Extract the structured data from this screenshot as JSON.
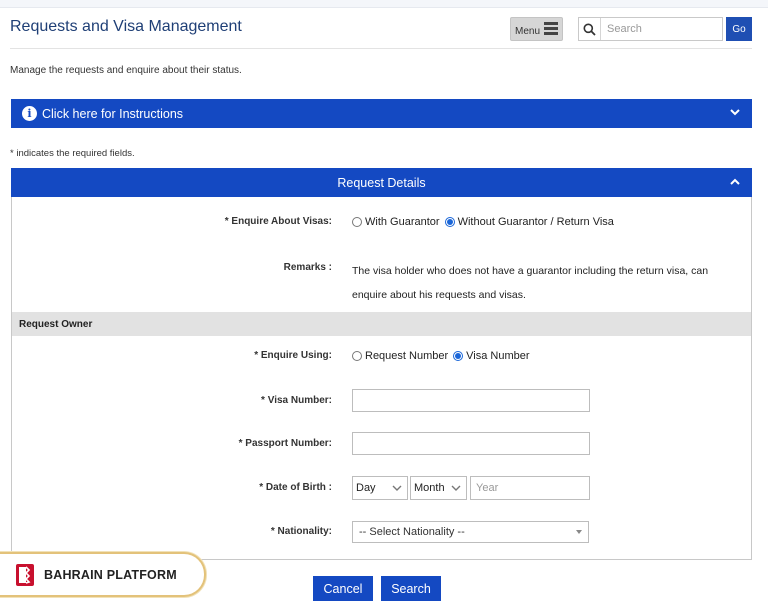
{
  "header": {
    "title": "Requests and Visa Management",
    "menu_label": "Menu",
    "search_placeholder": "Search",
    "go_label": "Go"
  },
  "intro_text": "Manage the requests and enquire about their status.",
  "instructions_label": "Click here for Instructions",
  "required_note": "* indicates the required fields.",
  "panel": {
    "title": "Request Details",
    "enquire_visas": {
      "label": "* Enquire About Visas:",
      "options": [
        "With Guarantor",
        "Without Guarantor / Return Visa"
      ],
      "selected": "Without Guarantor / Return Visa"
    },
    "remarks": {
      "label": "Remarks :",
      "text": "The visa holder who does not have a guarantor including the return visa, can enquire about his requests and visas."
    },
    "request_owner": {
      "title": "Request Owner",
      "enquire_using": {
        "label": "* Enquire Using:",
        "options": [
          "Request Number",
          "Visa Number"
        ],
        "selected": "Visa Number"
      },
      "visa_number_label": "* Visa Number:",
      "visa_number_value": "",
      "passport_number_label": "* Passport Number:",
      "passport_number_value": "",
      "dob": {
        "label": "* Date of Birth :",
        "day": "Day",
        "month": "Month",
        "year_placeholder": "Year"
      },
      "nationality": {
        "label": "* Nationality:",
        "selected": "-- Select Nationality --"
      }
    }
  },
  "buttons": {
    "cancel": "Cancel",
    "search": "Search"
  },
  "brand": "BAHRAIN PLATFORM",
  "colors": {
    "accent": "#1449c2",
    "title": "#1f3f76",
    "band": "#e2e2e2",
    "brand_border": "#e3c27a",
    "brand_red": "#c8102e"
  },
  "icons": [
    "menu-icon",
    "search-icon",
    "info-icon",
    "chevron-down-icon",
    "chevron-up-icon",
    "bahrain-platform-logo"
  ]
}
